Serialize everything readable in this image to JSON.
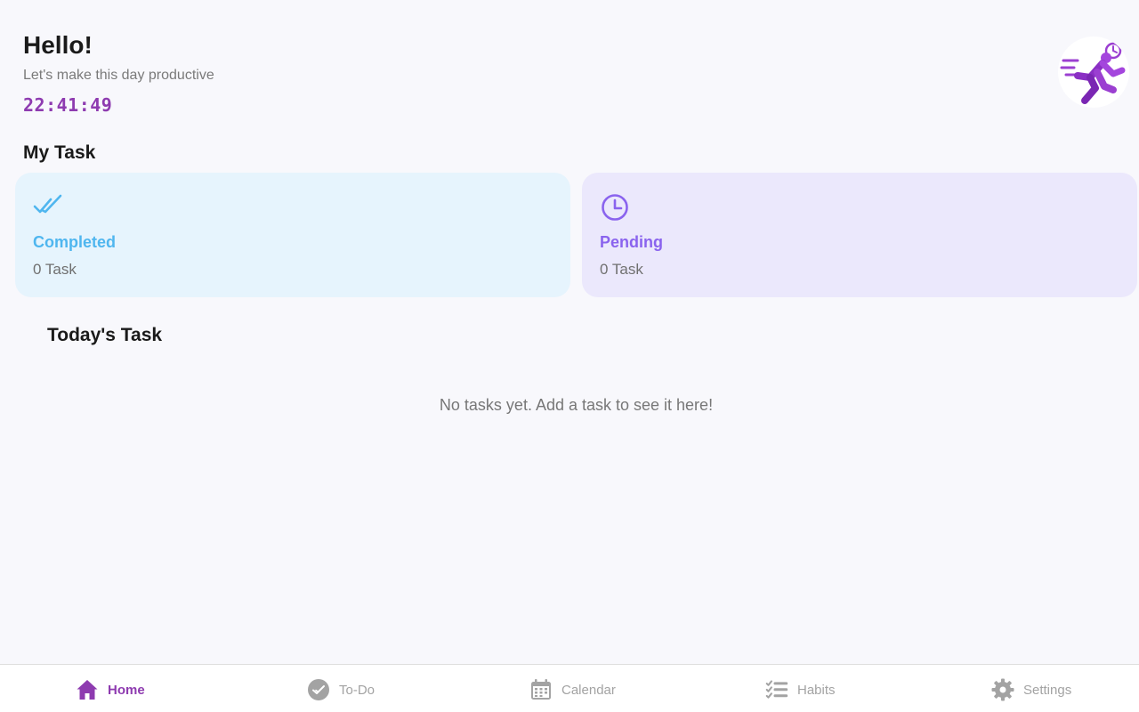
{
  "header": {
    "greeting": "Hello!",
    "subtitle": "Let's make this day productive",
    "clock": "22:41:49"
  },
  "avatar": {
    "icon": "running-person-clock-icon"
  },
  "my_task": {
    "title": "My Task",
    "cards": [
      {
        "label": "Completed",
        "count": "0 Task",
        "icon": "double-check-icon",
        "color": "#4fb6ef"
      },
      {
        "label": "Pending",
        "count": "0 Task",
        "icon": "clock-icon",
        "color": "#8a63ee"
      }
    ]
  },
  "today": {
    "title": "Today's Task",
    "empty_message": "No tasks yet. Add a task to see it here!"
  },
  "tabbar": {
    "active_color": "#8e3bb0",
    "inactive_color": "#a3a3a3",
    "tabs": [
      {
        "label": "Home",
        "icon": "home-icon",
        "active": true
      },
      {
        "label": "To-Do",
        "icon": "check-circle-icon",
        "active": false
      },
      {
        "label": "Calendar",
        "icon": "calendar-icon",
        "active": false
      },
      {
        "label": "Habits",
        "icon": "checklist-icon",
        "active": false
      },
      {
        "label": "Settings",
        "icon": "gear-icon",
        "active": false
      }
    ]
  }
}
